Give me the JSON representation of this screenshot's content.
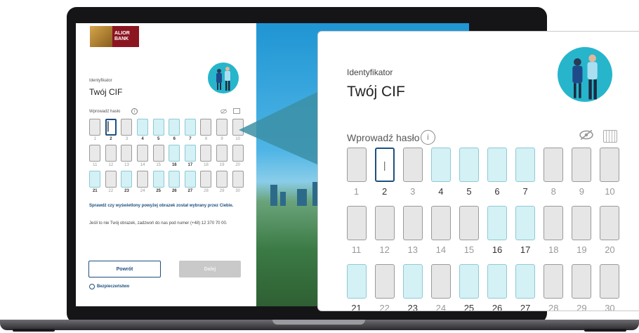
{
  "brand": {
    "name_line1": "ALIOR",
    "name_line2": "BANK"
  },
  "login": {
    "identifier_label": "Identyfikator",
    "identifier_value": "Twój CIF",
    "password_label": "Wprowadź hasło",
    "info_glyph": "i",
    "caret_glyph": "|",
    "check_image_text": "Sprawdź czy wyświetlony powyżej obrazek został wybrany przez Ciebie.",
    "not_your_image_text": "Jeśli to nie Twój obrazek, zadzwoń do nas pod numer (+48) 12 370 70 00.",
    "back_button": "Powrót",
    "next_button": "Dalej",
    "security_link": "Bezpieczeństwo",
    "password_positions": [
      {
        "num": "1",
        "required": false
      },
      {
        "num": "2",
        "required": true,
        "active": true
      },
      {
        "num": "3",
        "required": false
      },
      {
        "num": "4",
        "required": true
      },
      {
        "num": "5",
        "required": true
      },
      {
        "num": "6",
        "required": true
      },
      {
        "num": "7",
        "required": true
      },
      {
        "num": "8",
        "required": false
      },
      {
        "num": "9",
        "required": false
      },
      {
        "num": "10",
        "required": false
      },
      {
        "num": "11",
        "required": false
      },
      {
        "num": "12",
        "required": false
      },
      {
        "num": "13",
        "required": false
      },
      {
        "num": "14",
        "required": false
      },
      {
        "num": "15",
        "required": false
      },
      {
        "num": "16",
        "required": true
      },
      {
        "num": "17",
        "required": true
      },
      {
        "num": "18",
        "required": false
      },
      {
        "num": "19",
        "required": false
      },
      {
        "num": "20",
        "required": false
      },
      {
        "num": "21",
        "required": true
      },
      {
        "num": "22",
        "required": false
      },
      {
        "num": "23",
        "required": true
      },
      {
        "num": "24",
        "required": false
      },
      {
        "num": "25",
        "required": true
      },
      {
        "num": "26",
        "required": true
      },
      {
        "num": "27",
        "required": true
      },
      {
        "num": "28",
        "required": false
      },
      {
        "num": "29",
        "required": false
      },
      {
        "num": "30",
        "required": false
      }
    ]
  },
  "icons": {
    "info": "info-icon",
    "eye": "eye-slash-icon",
    "keyboard": "keyboard-icon",
    "shield": "shield-icon",
    "avatar": "user-avatar-illustration"
  },
  "colors": {
    "brand_red": "#8b1520",
    "primary_navy": "#1d4f7f",
    "teal_avatar": "#27b5cc",
    "required_cell": "#d4f1f6",
    "inactive_cell": "#e6e6e6",
    "disabled_button": "#c9c9c9"
  }
}
